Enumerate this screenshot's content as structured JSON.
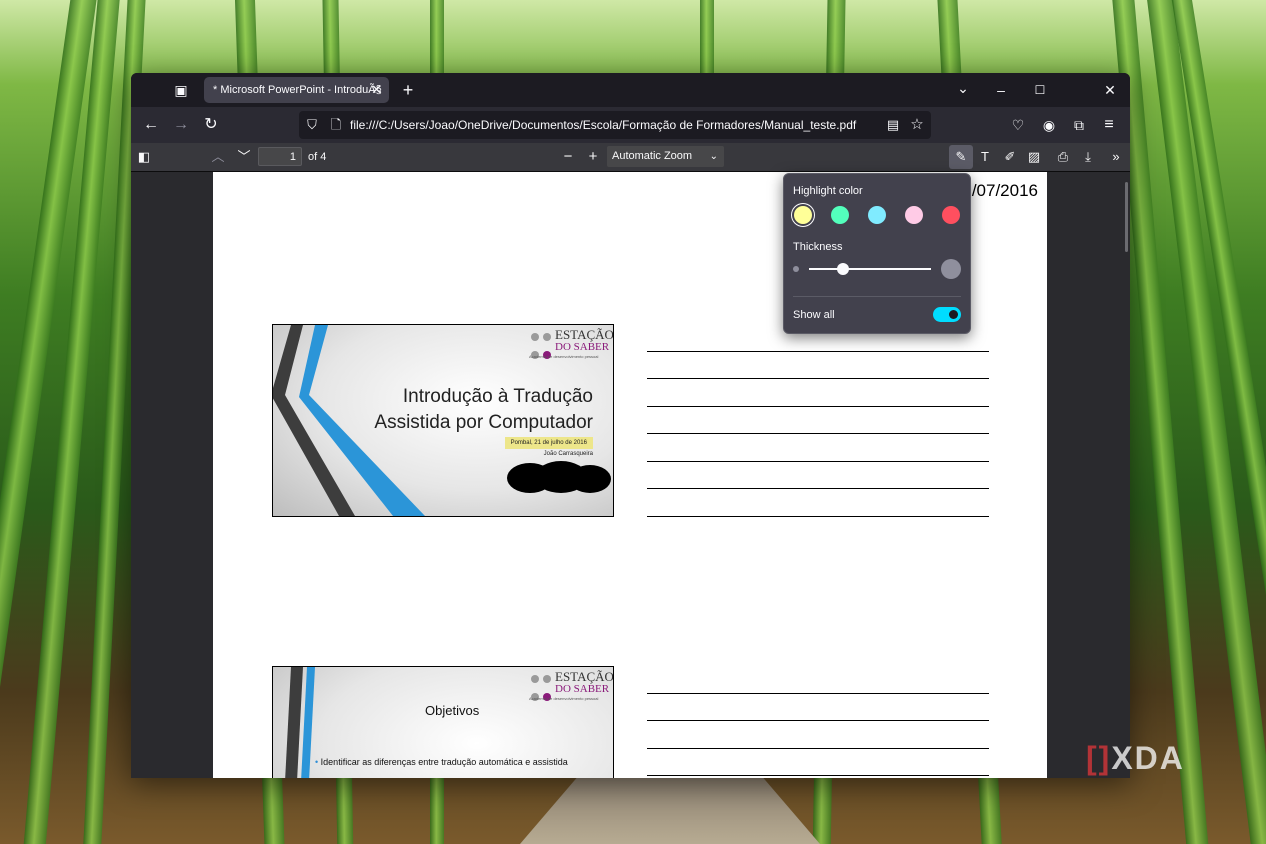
{
  "browser": {
    "tab_title": "* Microsoft PowerPoint - IntroduÃ§",
    "tab_close": "✕",
    "new_tab": "+",
    "list_all_tabs": "⌄",
    "minimize": "–",
    "maximize": "☐",
    "close": "✕",
    "back": "←",
    "forward": "→",
    "reload": "↻",
    "url": "file:///C:/Users/Joao/OneDrive/Documentos/Escola/Formação de Formadores/Manual_teste.pdf"
  },
  "pdf_toolbar": {
    "page_number": "1",
    "page_count": "of 4",
    "zoom_out": "−",
    "zoom_in": "+",
    "zoom_value": "Automatic Zoom"
  },
  "document": {
    "date_fragment": "/07/2016",
    "slide1": {
      "logo_top": "ESTAÇÃO",
      "logo_bottom": "DO SABER",
      "logo_tagline": "Academia de desenvolvimento pessoal",
      "title_line1": "Introdução à Tradução",
      "title_line2": "Assistida por Computador",
      "date": "Pombal, 21 de julho de 2016",
      "author": "João Carrasqueira"
    },
    "slide2": {
      "logo_top": "ESTAÇÃO",
      "logo_bottom": "DO SABER",
      "logo_tagline": "Academia de desenvolvimento pessoal",
      "title": "Objetivos",
      "bullet1": "Identificar as diferenças entre tradução automática e assistida"
    }
  },
  "highlight_popup": {
    "color_label": "Highlight color",
    "thickness_label": "Thickness",
    "thickness_value": 0.28,
    "show_all_label": "Show all",
    "show_all_enabled": true,
    "colors": [
      "#ffff98",
      "#53ffbc",
      "#80ebff",
      "#ffcbe6",
      "#ff4f5f"
    ],
    "selected_color": "#ffff98"
  },
  "watermark": {
    "bracket": "[]",
    "text": "XDA"
  }
}
